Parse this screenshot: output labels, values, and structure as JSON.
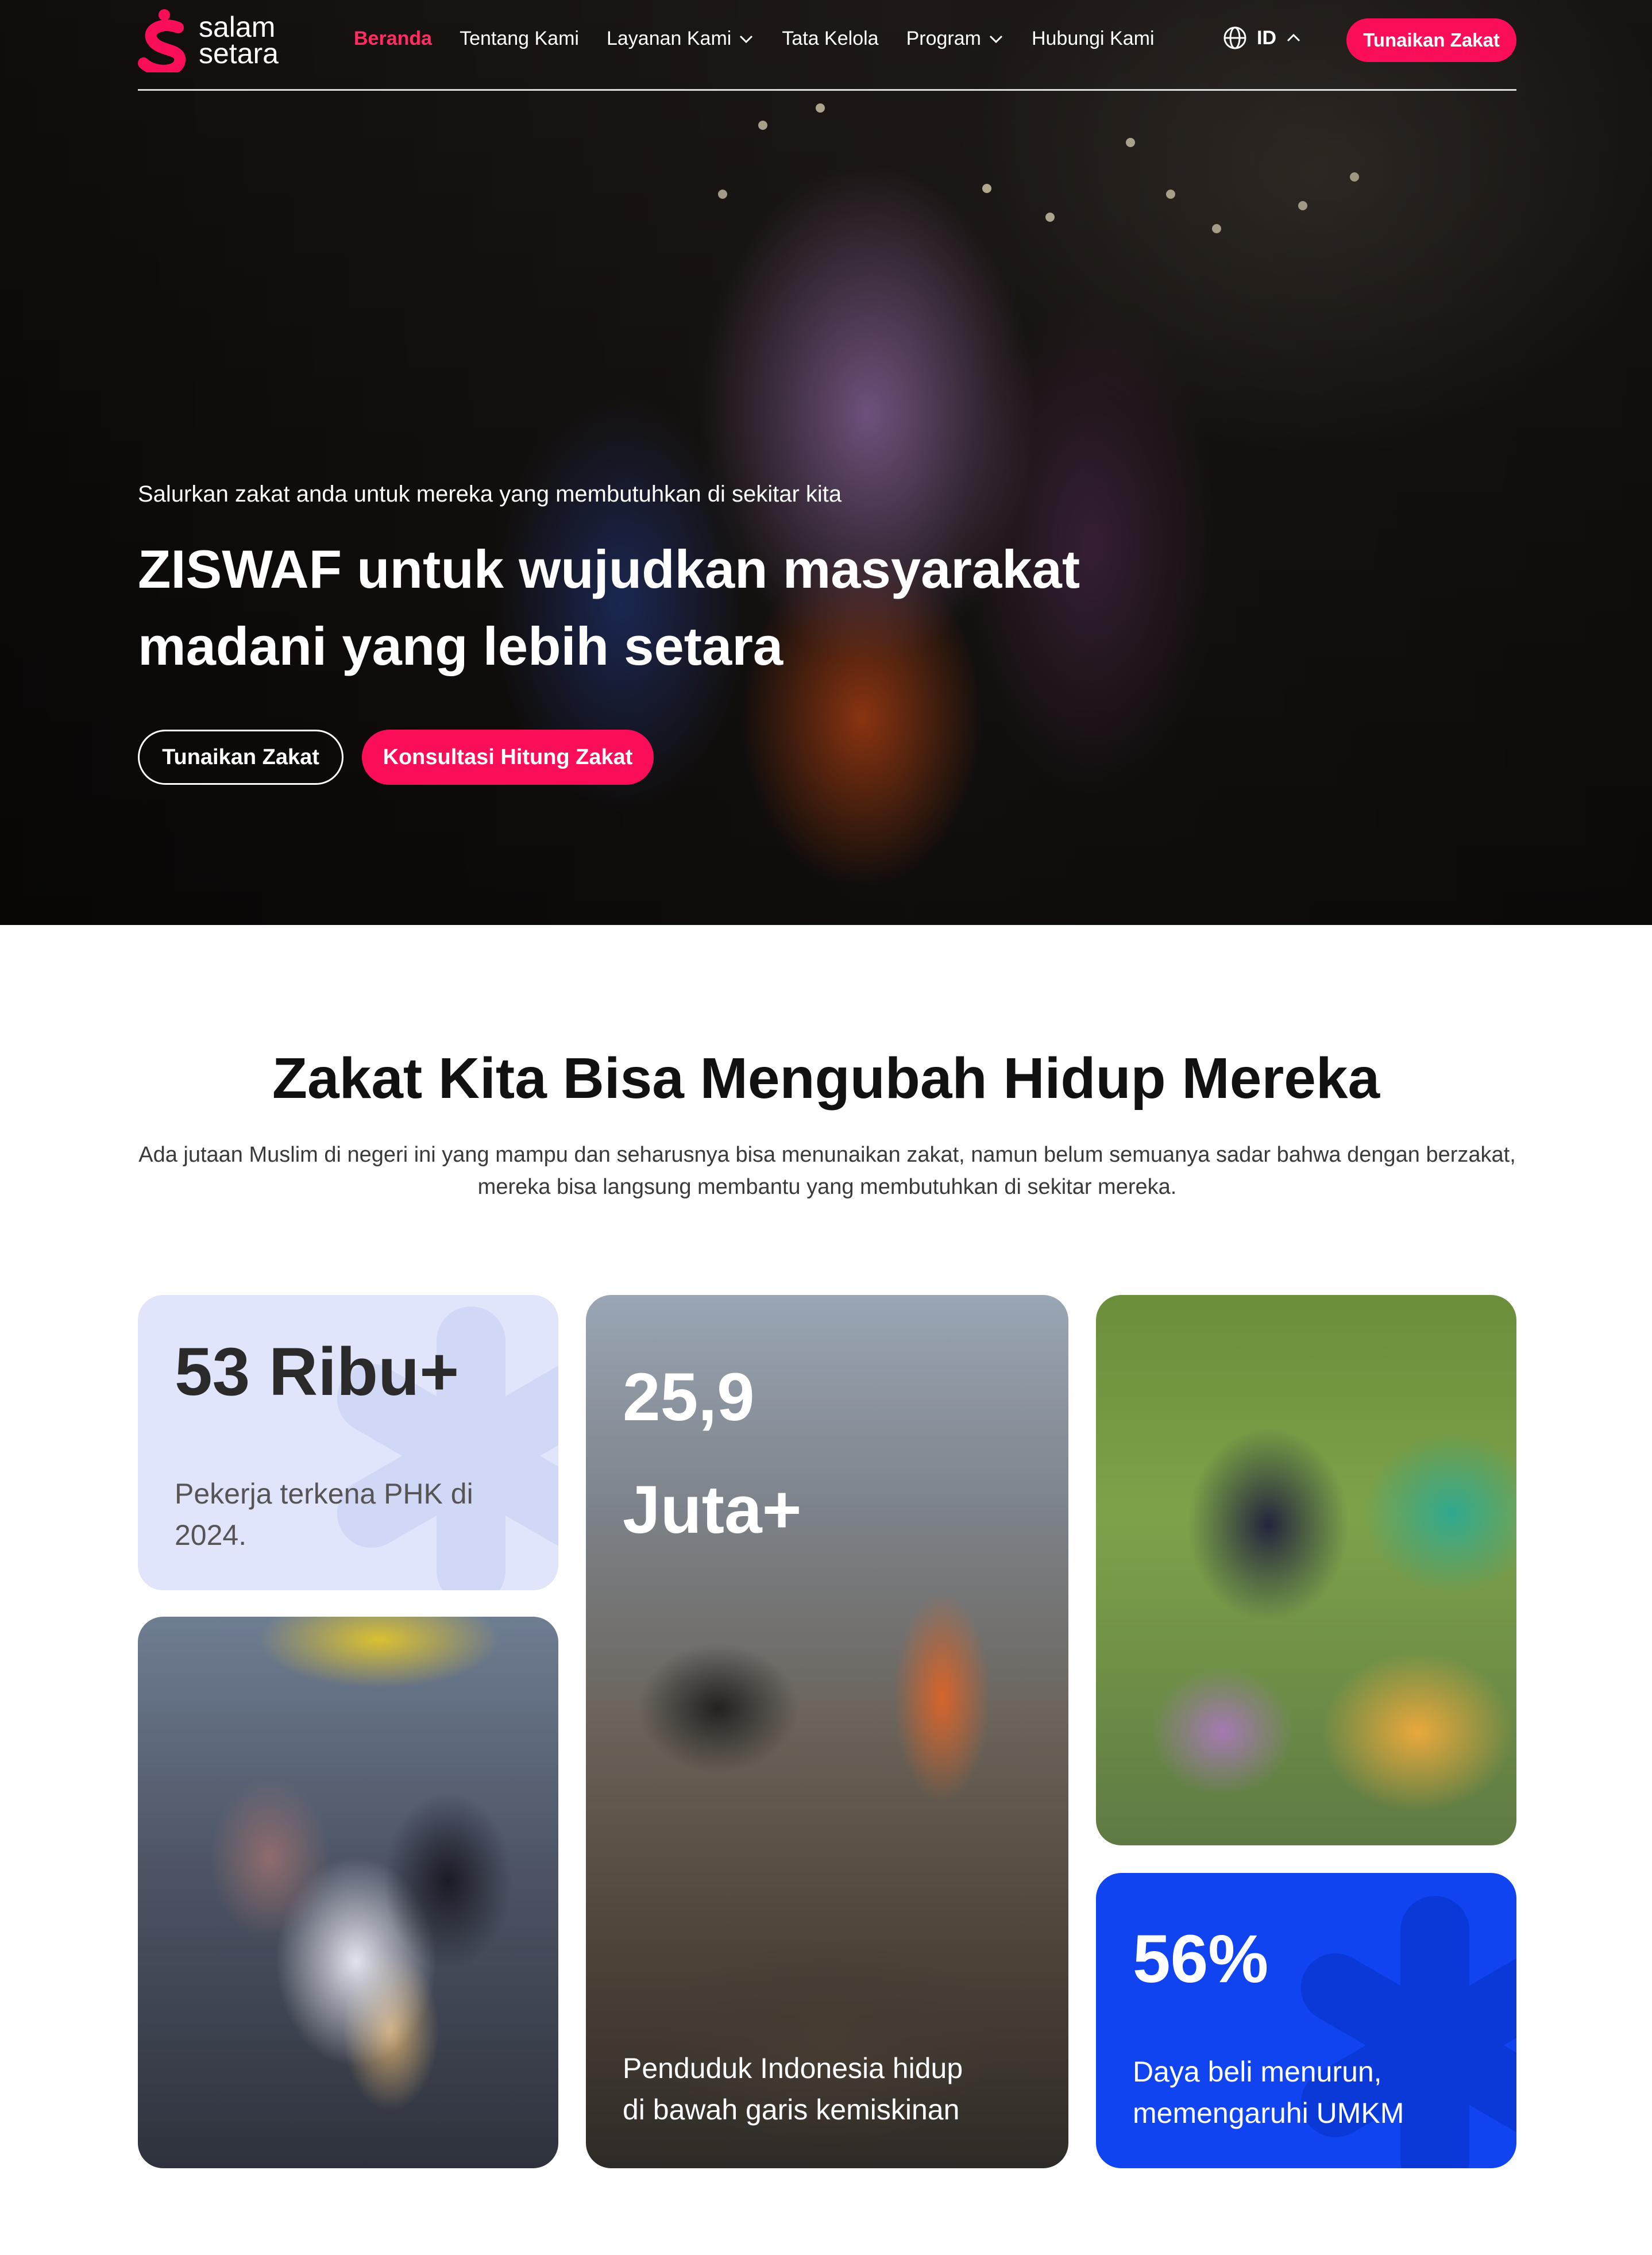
{
  "brand": {
    "name_line1": "salam",
    "name_line2": "setara",
    "accent": "#fb0e58",
    "blue": "#1044f0"
  },
  "nav": {
    "items": [
      {
        "label": "Beranda",
        "active": true
      },
      {
        "label": "Tentang Kami"
      },
      {
        "label": "Layanan Kami",
        "dropdown": true
      },
      {
        "label": "Tata Kelola"
      },
      {
        "label": "Program",
        "dropdown": true
      },
      {
        "label": "Hubungi Kami"
      }
    ],
    "language": "ID",
    "cta": "Tunaikan Zakat"
  },
  "hero": {
    "subtitle": "Salurkan zakat anda untuk mereka yang membutuhkan di sekitar kita",
    "title": "ZISWAF untuk wujudkan masyarakat madani yang lebih setara",
    "btn_primary": "Tunaikan Zakat",
    "btn_secondary": "Konsultasi Hitung Zakat"
  },
  "section": {
    "title": "Zakat Kita Bisa Mengubah Hidup Mereka",
    "description": "Ada jutaan Muslim di negeri ini yang mampu dan seharusnya bisa menunaikan zakat, namun belum semuanya sadar bahwa dengan berzakat, mereka bisa langsung membantu yang membutuhkan di sekitar mereka."
  },
  "stats": [
    {
      "value": "53 Ribu+",
      "label": "Pekerja terkena PHK di 2024."
    },
    {
      "value": "25,9 Juta+",
      "label": "Penduduk Indonesia hidup di bawah garis kemiskinan"
    },
    {
      "value": "56%",
      "label": "Daya beli menurun, memengaruhi UMKM"
    }
  ]
}
